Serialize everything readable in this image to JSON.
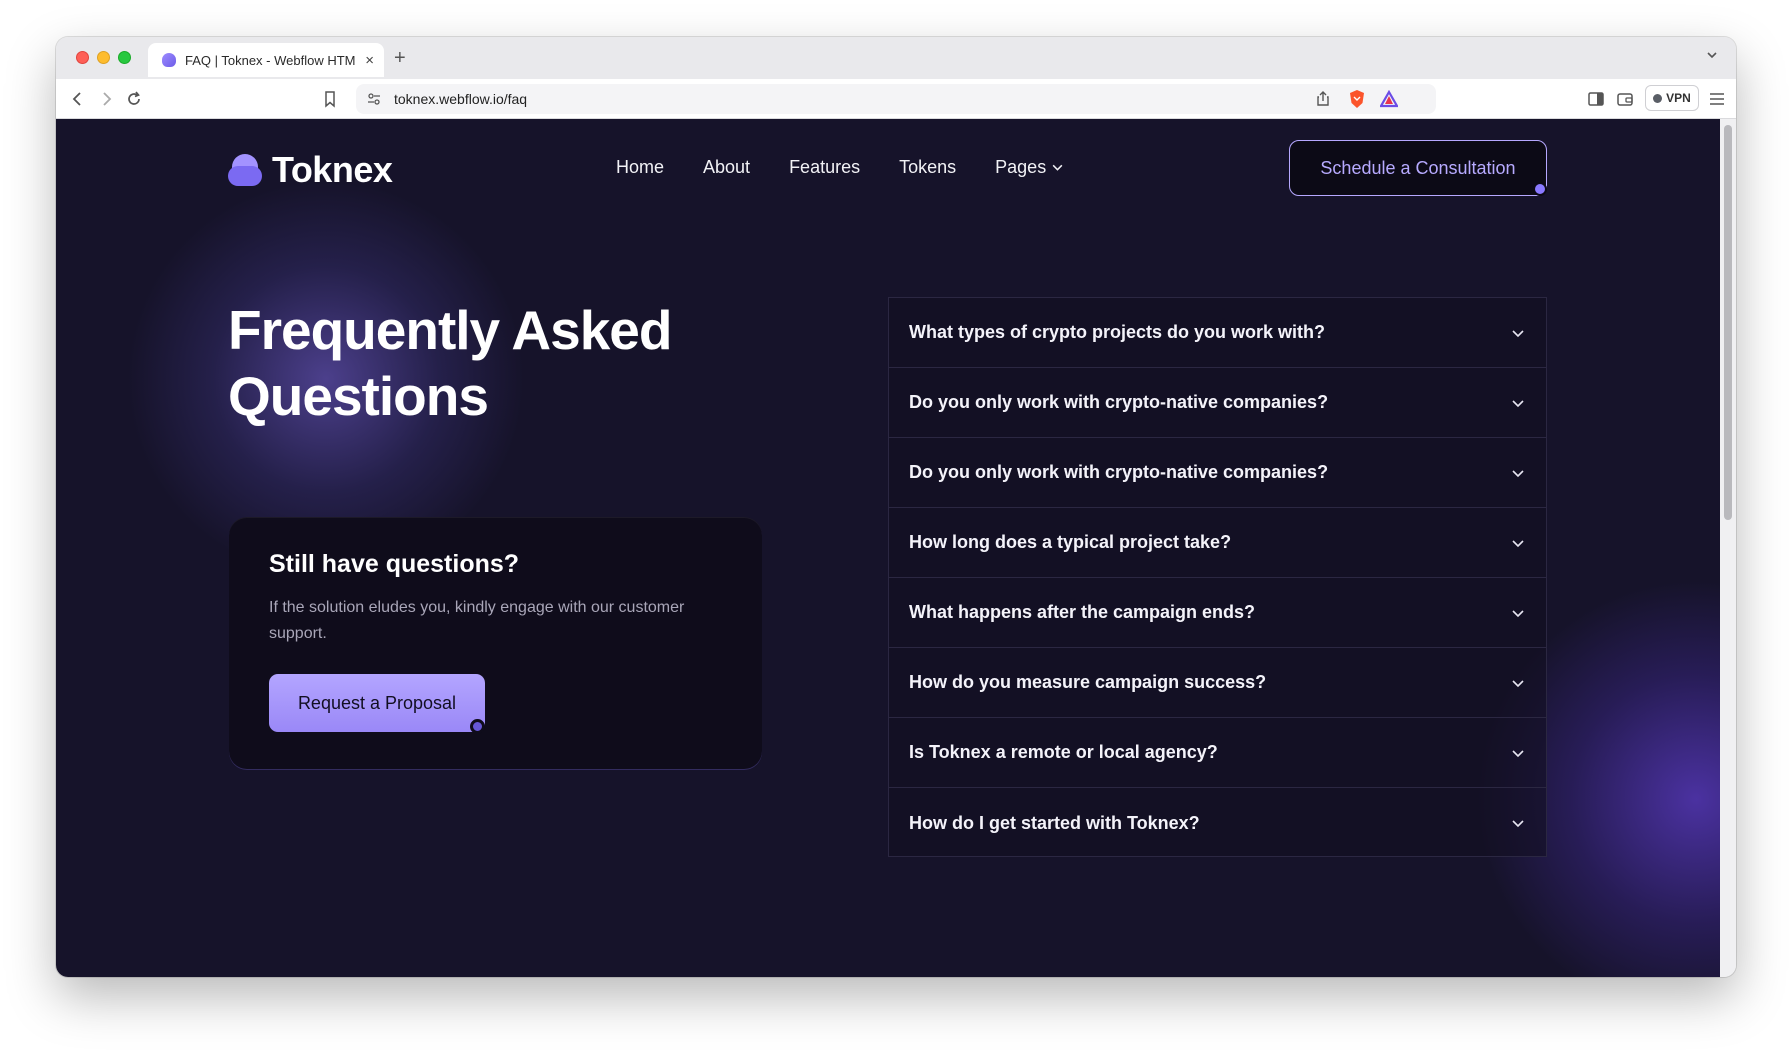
{
  "browser": {
    "tab_title": "FAQ | Toknex - Webflow HTM",
    "tab_close": "×",
    "new_tab": "+",
    "url": "toknex.webflow.io/faq",
    "vpn_label": "VPN"
  },
  "site": {
    "logo_text": "Toknex",
    "nav": [
      {
        "label": "Home"
      },
      {
        "label": "About"
      },
      {
        "label": "Features"
      },
      {
        "label": "Tokens"
      },
      {
        "label": "Pages"
      }
    ],
    "cta_label": "Schedule a Consultation"
  },
  "hero": {
    "title": "Frequently Asked Questions"
  },
  "help_card": {
    "title": "Still have questions?",
    "text": "If the solution eludes you,  kindly engage with our customer support.",
    "button_label": "Request a Proposal"
  },
  "faq": {
    "items": [
      {
        "question": "What types of crypto projects do you work with?"
      },
      {
        "question": "Do you only work with crypto-native companies?"
      },
      {
        "question": "Do you only work with crypto-native companies?"
      },
      {
        "question": "How long does a typical project take?"
      },
      {
        "question": "What happens after the campaign ends?"
      },
      {
        "question": "How do you measure campaign success?"
      },
      {
        "question": "Is Toknex a remote or local agency?"
      },
      {
        "question": "How do I get started with Toknex?"
      }
    ]
  },
  "colors": {
    "page_bg": "#16132a",
    "accent": "#a393ff",
    "card_bg": "#0f0c1b"
  }
}
